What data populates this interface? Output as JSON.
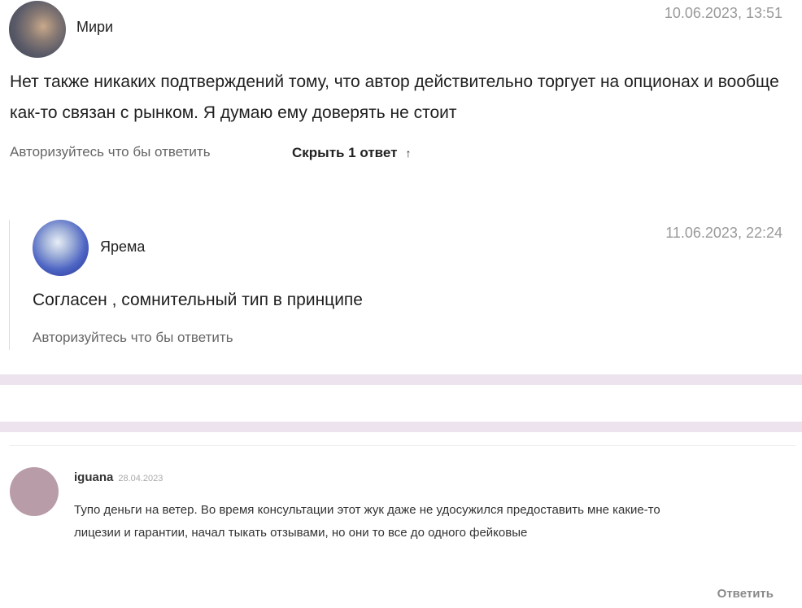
{
  "comment1": {
    "author": "Мири",
    "date": "10.06.2023, 13:51",
    "text": "Нет также никаких подтверждений тому, что автор действительно торгует на опционах и вообще как-то связан с рынком. Я думаю ему доверять не стоит",
    "reply_prompt": "Авторизуйтесь что бы ответить",
    "hide_replies": "Скрыть 1 ответ",
    "hide_icon": "arrow-up-icon",
    "avatar_icon": "user-photo"
  },
  "reply1": {
    "author": "Ярема",
    "date": "11.06.2023, 22:24",
    "text": "Согласен , сомнительный тип в принципе",
    "reply_prompt": "Авторизуйтесь что бы ответить",
    "avatar_icon": "user-photo"
  },
  "comment2": {
    "author": "iguana",
    "date": "28.04.2023",
    "text": "Тупо деньги на ветер. Во время консультации этот жук даже не удосужился предоставить мне какие-то лицезии и гарантии, начал тыкать отзывами, но они то все до одного фейковые",
    "reply_label": "Ответить",
    "avatar_color": "#b89ca8"
  },
  "colors": {
    "separator_band": "#ece3ee",
    "muted_text": "#9a9a9a"
  }
}
